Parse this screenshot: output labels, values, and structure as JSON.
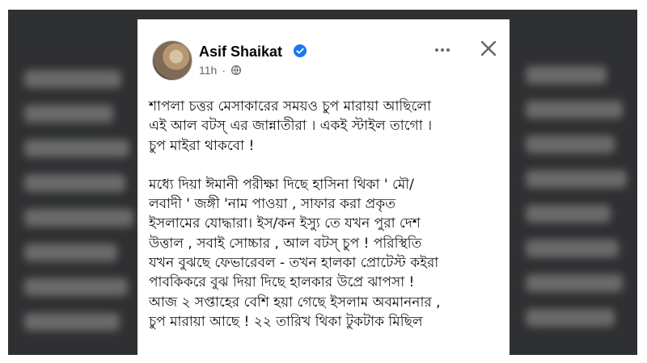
{
  "post": {
    "author": "Asif Shaikat",
    "time": "11h",
    "separator": "·",
    "paragraphs": [
      "শাপলা চত্তর মেসাকারের সময়ও চুপ মারায়া আছিলো\nএই আল বটস্ এর জান্নাতীরা । একই স্টাইল তাগো ।\nচুপ মাইরা থাকবো !",
      "মধ্যে দিয়া ঈমানী পরীক্ষা দিছে হাসিনা থিকা ' মৌ/\nলবাদী '  জঙ্গী 'নাম পাওয়া ,  সাফার করা প্রকৃত\nইসলামের যোদ্ধারা। ইস/কন ইস্যু তে যখন পুরা দেশ\nউত্তাল , সবাই সোচ্চার , আল বটস্ চুপ ! পরিস্থিতি\nযখন বুঝছে ফেভারেবল - তখন হালকা প্রোটেস্ট কইরা\nপাবকিকরে বুঝ দিয়া দিছে হালকার উপ্রে ঝাপসা !\nআজ ২ সপ্তাহের বেশি হয়া গেছে ইসলাম অবমাননার ,\nচুপ মারায়া আছে !  ২২ তারিখ থিকা টুকটাক মিছিল"
    ]
  },
  "icons": {
    "verified": "verified-badge-icon",
    "globe": "globe-icon",
    "more": "more-options-icon",
    "close": "close-icon"
  },
  "colors": {
    "verified": "#1877f2",
    "meta": "#65676b",
    "backdrop": "#2f3032"
  }
}
